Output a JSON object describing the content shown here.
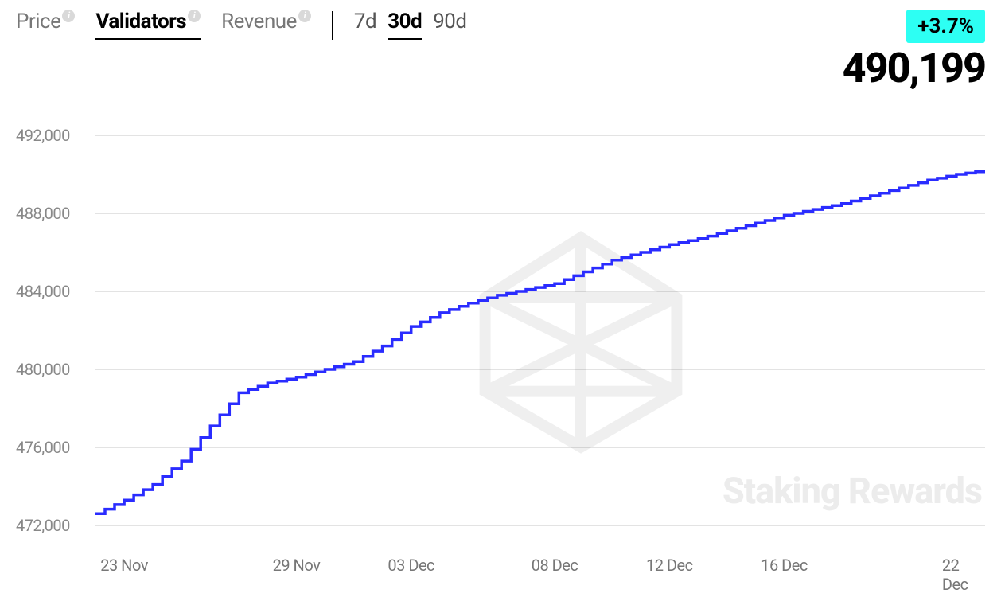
{
  "tabs": {
    "metrics": [
      {
        "label": "Price",
        "active": false
      },
      {
        "label": "Validators",
        "active": true
      },
      {
        "label": "Revenue",
        "active": false
      }
    ],
    "ranges": [
      {
        "label": "7d",
        "active": false
      },
      {
        "label": "30d",
        "active": true
      },
      {
        "label": "90d",
        "active": false
      }
    ]
  },
  "summary": {
    "change_pct": "+3.7%",
    "value": "490,199"
  },
  "watermark": "Staking Rewards",
  "chart_data": {
    "type": "line",
    "ylabel": "Validators",
    "xlabel": "",
    "ylim": [
      472000,
      492000
    ],
    "y_ticks": [
      472000,
      476000,
      480000,
      484000,
      488000,
      492000
    ],
    "y_tick_labels": [
      "472,000",
      "476,000",
      "480,000",
      "484,000",
      "488,000",
      "492,000"
    ],
    "x_tick_dates": [
      "23 Nov",
      "29 Nov",
      "03 Dec",
      "08 Dec",
      "12 Dec",
      "16 Dec",
      "22 Dec"
    ],
    "series": [
      {
        "name": "Validators",
        "points": [
          {
            "date": "22 Nov",
            "v": 472600
          },
          {
            "date": "23 Nov",
            "v": 473300
          },
          {
            "date": "24 Nov",
            "v": 474100
          },
          {
            "date": "25 Nov",
            "v": 475300
          },
          {
            "date": "26 Nov",
            "v": 477100
          },
          {
            "date": "27 Nov",
            "v": 478800
          },
          {
            "date": "28 Nov",
            "v": 479300
          },
          {
            "date": "29 Nov",
            "v": 479600
          },
          {
            "date": "30 Nov",
            "v": 480000
          },
          {
            "date": "01 Dec",
            "v": 480400
          },
          {
            "date": "02 Dec",
            "v": 481200
          },
          {
            "date": "03 Dec",
            "v": 482200
          },
          {
            "date": "04 Dec",
            "v": 482900
          },
          {
            "date": "05 Dec",
            "v": 483400
          },
          {
            "date": "06 Dec",
            "v": 483800
          },
          {
            "date": "07 Dec",
            "v": 484100
          },
          {
            "date": "08 Dec",
            "v": 484400
          },
          {
            "date": "09 Dec",
            "v": 485000
          },
          {
            "date": "10 Dec",
            "v": 485600
          },
          {
            "date": "11 Dec",
            "v": 486000
          },
          {
            "date": "12 Dec",
            "v": 486400
          },
          {
            "date": "13 Dec",
            "v": 486700
          },
          {
            "date": "14 Dec",
            "v": 487100
          },
          {
            "date": "15 Dec",
            "v": 487500
          },
          {
            "date": "16 Dec",
            "v": 487900
          },
          {
            "date": "17 Dec",
            "v": 488200
          },
          {
            "date": "18 Dec",
            "v": 488500
          },
          {
            "date": "19 Dec",
            "v": 488900
          },
          {
            "date": "20 Dec",
            "v": 489300
          },
          {
            "date": "21 Dec",
            "v": 489700
          },
          {
            "date": "22 Dec",
            "v": 490000
          },
          {
            "date": "23 Dec",
            "v": 490199
          }
        ]
      }
    ]
  }
}
